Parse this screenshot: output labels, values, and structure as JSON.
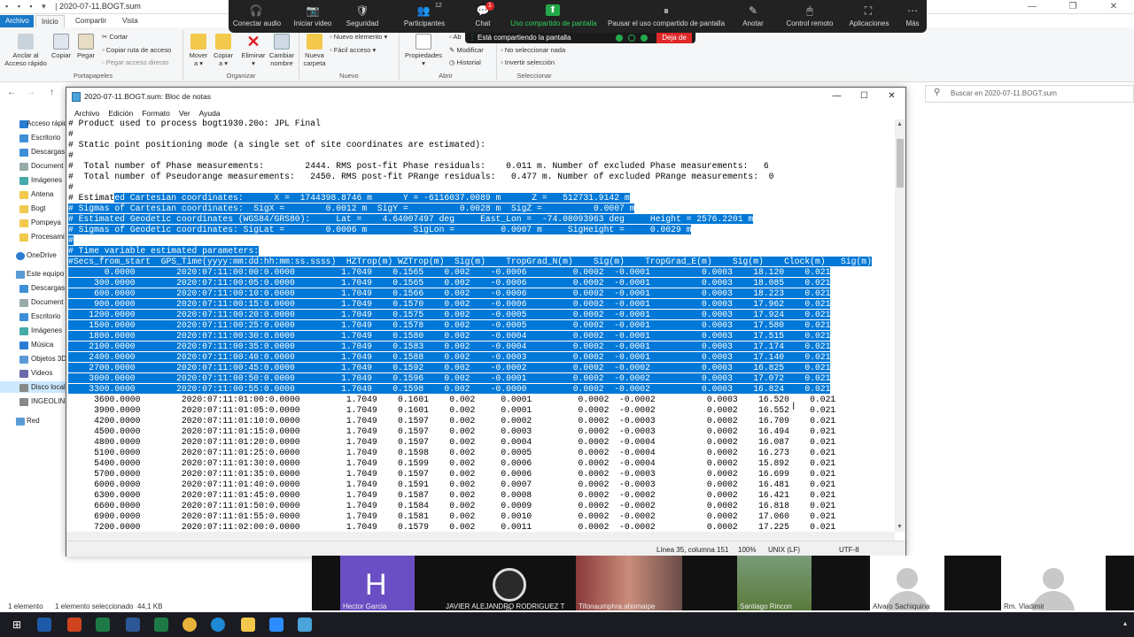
{
  "explorer": {
    "title": "2020-07-11.BOGT.sum",
    "quick_access_icons": "▪ ▪ ▪ ▾ |",
    "window_controls": [
      "—",
      "❐",
      "✕"
    ],
    "tabs": [
      "Archivo",
      "Inicio",
      "Compartir",
      "Vista"
    ],
    "ribbon": {
      "pin": "Anclar al\nAcceso rápido",
      "copy": "Copiar",
      "paste": "Pegar",
      "cut": "Cortar",
      "copy_path": "Copiar ruta de acceso",
      "paste_shortcut": "Pegar acceso directo",
      "move_to": "Mover\na ▾",
      "copy_to": "Copiar\na ▾",
      "delete": "Eliminar\n▾",
      "rename": "Cambiar\nnombre",
      "new_folder": "Nueva\ncarpeta",
      "new_item": "Nuevo elemento ▾",
      "easy_access": "Fácil acceso ▾",
      "properties": "Propiedades\n▾",
      "open": "Ab",
      "modify": "Modificar",
      "history": "Historial",
      "select_none": "No seleccionar nada",
      "invert_selection": "Invertir selección",
      "group_clipboard": "Portapapeles",
      "group_organize": "Organizar",
      "group_new": "Nuevo",
      "group_open": "Abrir",
      "group_select": "Seleccionar"
    },
    "search_placeholder": "Buscar en 2020-07-11.BOGT.sum",
    "nav_items": [
      "Acceso rápid",
      "Escritorio",
      "Descargas",
      "Document",
      "Imágenes",
      "Antena",
      "Bogt",
      "Pompeya",
      "Procesami",
      "OneDrive",
      "Este equipo",
      "Descargas",
      "Document",
      "Escritorio",
      "Imágenes",
      "Música",
      "Objetos 3D",
      "Videos",
      "Disco local",
      "INGEOLINK",
      "Red"
    ],
    "status_items": "1 elemento",
    "status_selected": "1 elemento seleccionado  44,1 KB"
  },
  "zoom": {
    "buttons": [
      {
        "label": "Conectar audio",
        "icon": "🎧"
      },
      {
        "label": "Iniciar video",
        "icon": "📷"
      },
      {
        "label": "Seguridad",
        "icon": "🛡"
      },
      {
        "label": "Participantes",
        "icon": "👥"
      },
      {
        "label": "Chat",
        "icon": "💬"
      },
      {
        "label": "Uso compartido de pantalla",
        "icon": "⬆"
      },
      {
        "label": "Pausar el uso compartido de pantalla",
        "icon": "⏸"
      },
      {
        "label": "Anotar",
        "icon": "✎"
      },
      {
        "label": "Control remoto",
        "icon": "🖱"
      },
      {
        "label": "Aplicaciones",
        "icon": "⛶"
      },
      {
        "label": "Más",
        "icon": "⋯"
      }
    ],
    "participant_count": "12",
    "chat_badge": "1",
    "share_status": "Está compartiendo la pantalla",
    "stop_label": "Deja de",
    "participants": [
      {
        "initial": "H",
        "name": "Hector Garcia"
      },
      {
        "initial": "",
        "name": "JAVIER ALEJANDRO RODRIGUEZ T"
      },
      {
        "initial": "",
        "name": "Tifonaumphra.ahomaipe"
      },
      {
        "initial": "",
        "name": "Santiago Rincon"
      },
      {
        "initial": "",
        "name": "Alvaro Sachiquina"
      },
      {
        "initial": "",
        "name": "Rm. Vladimir"
      }
    ]
  },
  "notepad": {
    "title": "2020-07-11.BOGT.sum: Bloc de notas",
    "window_controls": [
      "—",
      "☐",
      "✕"
    ],
    "menu": [
      "Archivo",
      "Edición",
      "Formato",
      "Ver",
      "Ayuda"
    ],
    "lines": [
      {
        "pre": "# Product used to process bogt1930.20o: JPL Final",
        "hl": "",
        "post": ""
      },
      {
        "pre": "#",
        "hl": "",
        "post": ""
      },
      {
        "pre": "# Static point positioning mode (a single set of site coordinates are estimated):",
        "hl": "",
        "post": ""
      },
      {
        "pre": "#",
        "hl": "",
        "post": ""
      },
      {
        "pre": "#  Total number of Phase measurements:        2444. RMS post-fit Phase residuals:    0.011 m. Number of excluded Phase measurements:   6",
        "hl": "",
        "post": ""
      },
      {
        "pre": "#  Total number of Pseudorange measurements:   2450. RMS post-fit PRange residuals:   0.477 m. Number of excluded PRange measurements:  0",
        "hl": "",
        "post": ""
      },
      {
        "pre": "#",
        "hl": "",
        "post": ""
      },
      {
        "pre": "# Estimat",
        "hl": "ed Cartesian coordinates:      X =  1744398.8746 m      Y = -6116037.0089 m      Z =   512731.9142 m",
        "post": ""
      },
      {
        "pre": "",
        "hl": "# Sigmas of Cartesian coordinates:  SigX =        0.0012 m  SigY =          0.0028 m  SigZ =          0.0007 m",
        "post": ""
      },
      {
        "pre": "",
        "hl": "# Estimated Geodetic coordinates (WGS84/GRS80):     Lat =    4.64007497 deg     East_Lon =  -74.08093963 deg     Height = 2576.2201 m",
        "post": ""
      },
      {
        "pre": "",
        "hl": "# Sigmas of Geodetic coordinates: SigLat =        0.0006 m         SigLon =         0.0007 m     SigHeight =     0.0029 m",
        "post": ""
      },
      {
        "pre": "",
        "hl": "#",
        "post": ""
      },
      {
        "pre": "",
        "hl": "# Time variable estimated parameters:",
        "post": ""
      },
      {
        "pre": "",
        "hl": "#Secs_from_start  GPS_Time(yyyy:mm:dd:hh:mm:ss.ssss)  HZTrop(m) WZTrop(m)  Sig(m)    TropGrad_N(m)    Sig(m)    TropGrad_E(m)    Sig(m)    Clock(m)   Sig(m)",
        "post": ""
      },
      {
        "pre": "",
        "hl": "       0.0000        2020:07:11:00:00:0.0000         1.7049    0.1565    0.002    -0.0006         0.0002  -0.0001          0.0003    18.120    0.021",
        "post": ""
      },
      {
        "pre": "",
        "hl": "     300.0000        2020:07:11:00:05:0.0000         1.7049    0.1565    0.002    -0.0006         0.0002  -0.0001          0.0003    18.085    0.021",
        "post": ""
      },
      {
        "pre": "",
        "hl": "     600.0000        2020:07:11:00:10:0.0000         1.7049    0.1566    0.002    -0.0006         0.0002  -0.0001          0.0003    18.223    0.021",
        "post": ""
      },
      {
        "pre": "",
        "hl": "     900.0000        2020:07:11:00:15:0.0000         1.7049    0.1570    0.002    -0.0006         0.0002  -0.0001          0.0003    17.962    0.021",
        "post": ""
      },
      {
        "pre": "",
        "hl": "    1200.0000        2020:07:11:00:20:0.0000         1.7049    0.1575    0.002    -0.0005         0.0002  -0.0001          0.0003    17.924    0.021",
        "post": ""
      },
      {
        "pre": "",
        "hl": "    1500.0000        2020:07:11:00:25:0.0000         1.7049    0.1578    0.002    -0.0005         0.0002  -0.0001          0.0003    17.580    0.021",
        "post": ""
      },
      {
        "pre": "",
        "hl": "    1800.0000        2020:07:11:00:30:0.0000         1.7049    0.1580    0.002    -0.0004         0.0002  -0.0001          0.0003    17.515    0.021",
        "post": ""
      },
      {
        "pre": "",
        "hl": "    2100.0000        2020:07:11:00:35:0.0000         1.7049    0.1583    0.002    -0.0004         0.0002  -0.0001          0.0003    17.174    0.021",
        "post": ""
      },
      {
        "pre": "",
        "hl": "    2400.0000        2020:07:11:00:40:0.0000         1.7049    0.1588    0.002    -0.0003         0.0002  -0.0001          0.0003    17.140    0.021",
        "post": ""
      },
      {
        "pre": "",
        "hl": "    2700.0000        2020:07:11:00:45:0.0000         1.7049    0.1592    0.002    -0.0002         0.0002  -0.0002          0.0003    16.825    0.021",
        "post": ""
      },
      {
        "pre": "",
        "hl": "    3000.0000        2020:07:11:00:50:0.0000         1.7049    0.1596    0.002    -0.0001         0.0002  -0.0002          0.0003    17.072    0.021",
        "post": ""
      },
      {
        "pre": "",
        "hl": "    3300.0000        2020:07:11:00:55:0.0000         1.7049    0.1598    0.002    -0.0000         0.0002  -0.0002          0.0003    16.824    0.021",
        "post": ""
      },
      {
        "pre": "     3600.0000        2020:07:11:01:00:0.0000         1.7049    0.1601    0.002     0.0001         0.0002  -0.0002          0.0003    16.520    0.021",
        "hl": "",
        "post": ""
      },
      {
        "pre": "     3900.0000        2020:07:11:01:05:0.0000         1.7049    0.1601    0.002     0.0001         0.0002  -0.0002          0.0002    16.552    0.021",
        "hl": "",
        "post": ""
      },
      {
        "pre": "     4200.0000        2020:07:11:01:10:0.0000         1.7049    0.1597    0.002     0.0002         0.0002  -0.0003          0.0002    16.709    0.021",
        "hl": "",
        "post": ""
      },
      {
        "pre": "     4500.0000        2020:07:11:01:15:0.0000         1.7049    0.1597    0.002     0.0003         0.0002  -0.0003          0.0002    16.494    0.021",
        "hl": "",
        "post": ""
      },
      {
        "pre": "     4800.0000        2020:07:11:01:20:0.0000         1.7049    0.1597    0.002     0.0004         0.0002  -0.0004          0.0002    16.087    0.021",
        "hl": "",
        "post": ""
      },
      {
        "pre": "     5100.0000        2020:07:11:01:25:0.0000         1.7049    0.1598    0.002     0.0005         0.0002  -0.0004          0.0002    16.273    0.021",
        "hl": "",
        "post": ""
      },
      {
        "pre": "     5400.0000        2020:07:11:01:30:0.0000         1.7049    0.1599    0.002     0.0006         0.0002  -0.0004          0.0002    15.892    0.021",
        "hl": "",
        "post": ""
      },
      {
        "pre": "     5700.0000        2020:07:11:01:35:0.0000         1.7049    0.1597    0.002     0.0006         0.0002  -0.0003          0.0002    16.699    0.021",
        "hl": "",
        "post": ""
      },
      {
        "pre": "     6000.0000        2020:07:11:01:40:0.0000         1.7049    0.1591    0.002     0.0007         0.0002  -0.0003          0.0002    16.481    0.021",
        "hl": "",
        "post": ""
      },
      {
        "pre": "     6300.0000        2020:07:11:01:45:0.0000         1.7049    0.1587    0.002     0.0008         0.0002  -0.0002          0.0002    16.421    0.021",
        "hl": "",
        "post": ""
      },
      {
        "pre": "     6600.0000        2020:07:11:01:50:0.0000         1.7049    0.1584    0.002     0.0009         0.0002  -0.0002          0.0002    16.818    0.021",
        "hl": "",
        "post": ""
      },
      {
        "pre": "     6900.0000        2020:07:11:01:55:0.0000         1.7049    0.1581    0.002     0.0010         0.0002  -0.0002          0.0002    17.060    0.021",
        "hl": "",
        "post": ""
      },
      {
        "pre": "     7200.0000        2020:07:11:02:00:0.0000         1.7049    0.1579    0.002     0.0011         0.0002  -0.0002          0.0002    17.225    0.021",
        "hl": "",
        "post": ""
      }
    ],
    "status": {
      "position": "Línea 35, columna 151",
      "zoom": "100%",
      "eol": "UNIX (LF)",
      "encoding": "UTF-8"
    }
  },
  "colors": {
    "selection": "#0078d7",
    "zoom_bar": "#222222",
    "share_green": "#25a84a",
    "stop_red": "#e02828",
    "file_tab": "#1979ca"
  }
}
